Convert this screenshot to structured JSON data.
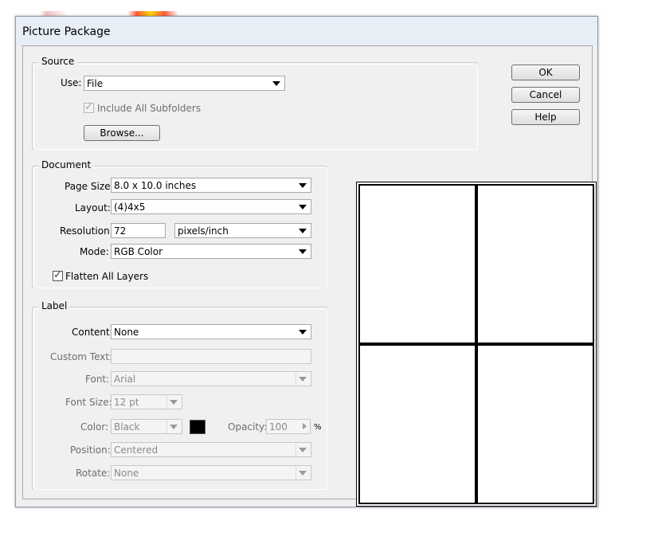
{
  "window": {
    "title": "Picture Package"
  },
  "buttons": {
    "ok": "OK",
    "cancel": "Cancel",
    "help": "Help"
  },
  "source": {
    "legend": "Source",
    "use_label": "Use:",
    "use_value": "File",
    "include_subfolders_label": "Include All Subfolders",
    "include_subfolders_checked": true,
    "browse_label": "Browse..."
  },
  "document": {
    "legend": "Document",
    "page_size_label": "Page Size:",
    "page_size_value": "8.0 x 10.0 inches",
    "layout_label": "Layout:",
    "layout_value": "(4)4x5",
    "resolution_label": "Resolution:",
    "resolution_value": "72",
    "resolution_unit": "pixels/inch",
    "mode_label": "Mode:",
    "mode_value": "RGB Color",
    "flatten_label": "Flatten All Layers",
    "flatten_checked": true
  },
  "label": {
    "legend": "Label",
    "content_label": "Content:",
    "content_value": "None",
    "custom_text_label": "Custom Text:",
    "custom_text_value": "",
    "font_label": "Font:",
    "font_value": "Arial",
    "font_size_label": "Font Size:",
    "font_size_value": "12 pt",
    "color_label": "Color:",
    "color_value": "Black",
    "color_swatch": "#000000",
    "opacity_label": "Opacity:",
    "opacity_value": "100",
    "opacity_unit": "%",
    "position_label": "Position:",
    "position_value": "Centered",
    "rotate_label": "Rotate:",
    "rotate_value": "None"
  },
  "icons": {
    "checkbox_mark": "checkmark-icon",
    "dropdown": "chevron-down-icon",
    "spinner": "spinner-arrow-icon"
  }
}
